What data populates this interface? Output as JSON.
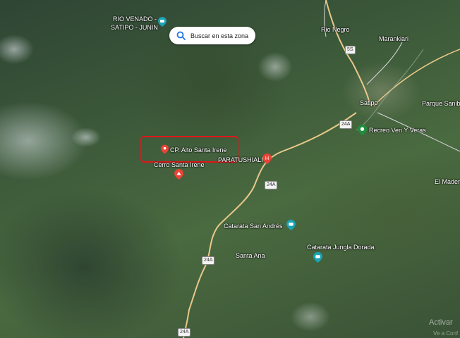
{
  "search": {
    "label": "Buscar en esta zona"
  },
  "places": {
    "rio_venado_line1": "RIO VENADO -",
    "rio_venado_line2": "SATIPO - JUNIN",
    "rio_negro": "Rio Negro",
    "marankiari": "Marankiari",
    "satipo": "Satipo",
    "parque": "Parque Sanib",
    "recreo": "Recreo Ven Y Veras",
    "cp_alto": "CP. Alto Santa Irene",
    "paratushiali": "PARATUSHIALI",
    "cerro": "Cerro Santa Irene",
    "el_mader": "El Mader",
    "catarata_sa": "Catarata San Andrés",
    "catarata_jd": "Catarata Jungla Dorada",
    "santa_ana": "Santa Ana"
  },
  "road_shields": {
    "r5s": "5S",
    "r24a_1": "24A",
    "r24a_2": "24A",
    "r24a_3": "24A",
    "r24a_4": "24A"
  },
  "watermark": {
    "line1": "Activar",
    "line2": "Ve a Conf"
  },
  "colors": {
    "highlight": "#e0161a",
    "pin_red": "#ea4335",
    "pin_teal": "#1aa3b5",
    "pin_green": "#1e8e3e"
  }
}
